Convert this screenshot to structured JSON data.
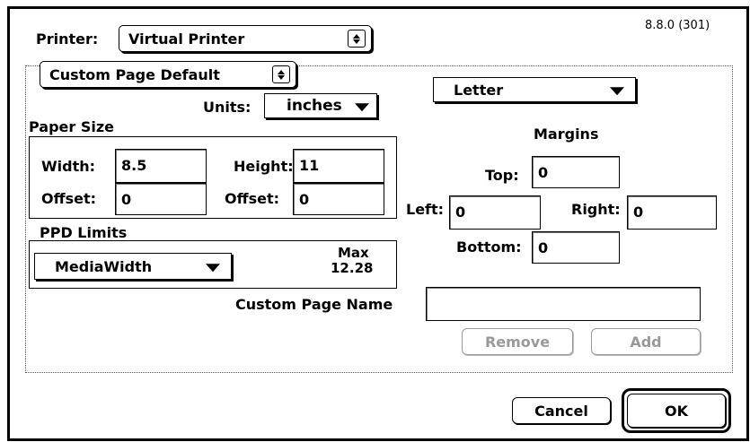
{
  "version": "8.8.0 (301)",
  "printer": {
    "label": "Printer:",
    "value": "Virtual Printer"
  },
  "page_preset": {
    "value": "Custom Page Default"
  },
  "paper_preset": {
    "value": "Letter"
  },
  "units": {
    "label": "Units:",
    "value": "inches"
  },
  "paper_size": {
    "title": "Paper Size",
    "width_label": "Width:",
    "width_value": "8.5",
    "height_label": "Height:",
    "height_value": "11",
    "offset_label": "Offset:",
    "offset_left_value": "0",
    "offset_right_value": "0"
  },
  "ppd_limits": {
    "title": "PPD Limits",
    "select_value": "MediaWidth",
    "max_label": "Max",
    "max_value": "12.28"
  },
  "margins": {
    "title": "Margins",
    "top_label": "Top:",
    "top_value": "0",
    "left_label": "Left:",
    "left_value": "0",
    "right_label": "Right:",
    "right_value": "0",
    "bottom_label": "Bottom:",
    "bottom_value": "0"
  },
  "custom_page_name": {
    "label": "Custom Page Name",
    "value": ""
  },
  "buttons": {
    "remove": "Remove",
    "add": "Add",
    "cancel": "Cancel",
    "ok": "OK"
  }
}
